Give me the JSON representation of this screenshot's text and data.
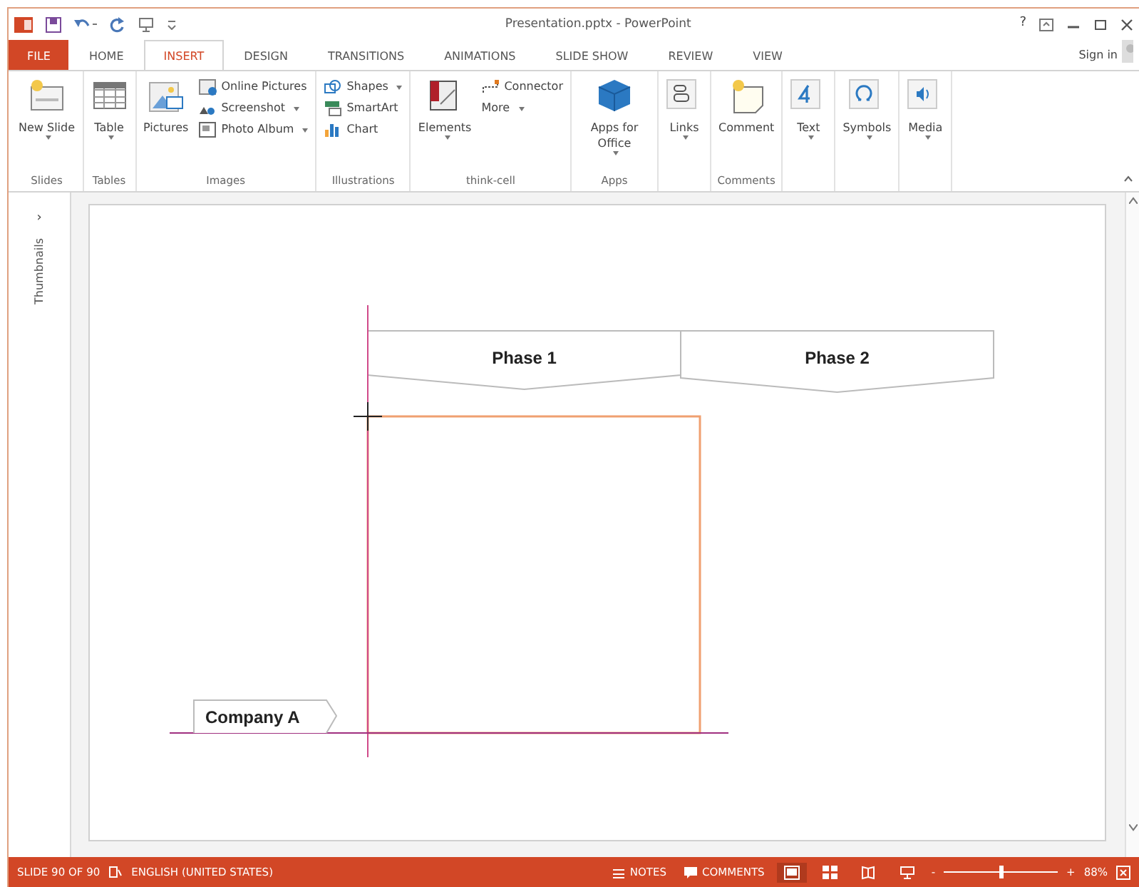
{
  "title_bar": {
    "title": "Presentation.pptx - PowerPoint",
    "help": "?"
  },
  "tabs": [
    {
      "label": "FILE",
      "kind": "file",
      "selected": false
    },
    {
      "label": "HOME",
      "kind": "tab",
      "selected": false
    },
    {
      "label": "INSERT",
      "kind": "tab",
      "selected": true
    },
    {
      "label": "DESIGN",
      "kind": "tab",
      "selected": false
    },
    {
      "label": "TRANSITIONS",
      "kind": "tab",
      "selected": false
    },
    {
      "label": "ANIMATIONS",
      "kind": "tab",
      "selected": false
    },
    {
      "label": "SLIDE SHOW",
      "kind": "tab",
      "selected": false
    },
    {
      "label": "REVIEW",
      "kind": "tab",
      "selected": false
    },
    {
      "label": "VIEW",
      "kind": "tab",
      "selected": false
    }
  ],
  "sign_in": "Sign in",
  "ribbon": {
    "groups": [
      {
        "label": "Slides",
        "columns": [
          {
            "kind": "large",
            "items": [
              {
                "label": "New Slide",
                "dropdown": true
              }
            ]
          }
        ]
      },
      {
        "label": "Tables",
        "columns": [
          {
            "kind": "large",
            "items": [
              {
                "label": "Table",
                "dropdown": true
              }
            ]
          }
        ]
      },
      {
        "label": "Images",
        "columns": [
          {
            "kind": "large",
            "items": [
              {
                "label": "Pictures",
                "dropdown": false
              }
            ]
          },
          {
            "kind": "small",
            "items": [
              {
                "label": "Online Pictures",
                "dropdown": false
              },
              {
                "label": "Screenshot",
                "dropdown": true
              },
              {
                "label": "Photo Album",
                "dropdown": true
              }
            ]
          }
        ]
      },
      {
        "label": "Illustrations",
        "columns": [
          {
            "kind": "small",
            "items": [
              {
                "label": "Shapes",
                "dropdown": true
              },
              {
                "label": "SmartArt",
                "dropdown": false
              },
              {
                "label": "Chart",
                "dropdown": false
              }
            ]
          }
        ]
      },
      {
        "label": "think-cell",
        "columns": [
          {
            "kind": "large",
            "items": [
              {
                "label": "Elements",
                "dropdown": true
              }
            ]
          },
          {
            "kind": "small",
            "items": [
              {
                "label": "Connector",
                "dropdown": false
              },
              {
                "label": "More",
                "dropdown": true
              }
            ]
          }
        ]
      },
      {
        "label": "Apps",
        "columns": [
          {
            "kind": "large",
            "items": [
              {
                "label": "Apps for Office",
                "dropdown": true
              }
            ]
          }
        ]
      },
      {
        "columns": [
          {
            "kind": "large",
            "items": [
              {
                "label": "Links",
                "dropdown": true
              }
            ]
          }
        ]
      },
      {
        "label": "Comments",
        "columns": [
          {
            "kind": "large",
            "items": [
              {
                "label": "Comment",
                "dropdown": false
              }
            ]
          }
        ]
      },
      {
        "columns": [
          {
            "kind": "large",
            "items": [
              {
                "label": "Text",
                "dropdown": true
              }
            ]
          }
        ]
      },
      {
        "columns": [
          {
            "kind": "large",
            "items": [
              {
                "label": "Symbols",
                "dropdown": true
              }
            ]
          }
        ]
      },
      {
        "columns": [
          {
            "kind": "large",
            "items": [
              {
                "label": "Media",
                "dropdown": true
              }
            ]
          }
        ]
      }
    ]
  },
  "thumbnails_pane": {
    "toggle": "›",
    "label": "Thumbnails"
  },
  "slide": {
    "phases": [
      {
        "label": "Phase 1"
      },
      {
        "label": "Phase 2"
      }
    ],
    "rows": [
      {
        "label": "Company A"
      }
    ]
  },
  "status_bar": {
    "slide": "SLIDE 90 OF 90",
    "language": "ENGLISH (UNITED STATES)",
    "notes": "NOTES",
    "comments": "COMMENTS",
    "views": [
      {
        "selected": true
      },
      {
        "selected": false
      },
      {
        "selected": false
      },
      {
        "selected": false
      }
    ],
    "zoom_out": "-",
    "zoom_in": "+",
    "zoom": {
      "level": 0.5
    },
    "zoom_reading": "88%"
  }
}
